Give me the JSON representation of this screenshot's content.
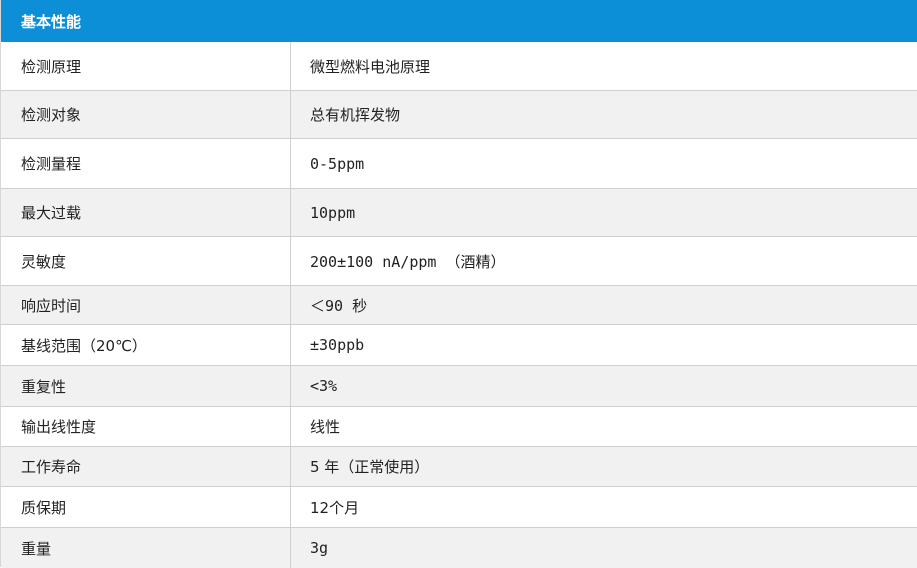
{
  "table": {
    "title": "基本性能",
    "rows": [
      {
        "label": "检测原理",
        "value": "微型燃料电池原理"
      },
      {
        "label": "检测对象",
        "value": "总有机挥发物"
      },
      {
        "label": "检测量程",
        "value": "0-5ppm"
      },
      {
        "label": "最大过载",
        "value": "10ppm"
      },
      {
        "label": "灵敏度",
        "value": "200±100 nA/ppm （酒精）"
      },
      {
        "label": "响应时间",
        "value": "＜90 秒"
      },
      {
        "label": "基线范围（20℃）",
        "value": "±30ppb"
      },
      {
        "label": "重复性",
        "value": "<3%"
      },
      {
        "label": "输出线性度",
        "value": "线性"
      },
      {
        "label": "工作寿命",
        "value": "5 年（正常使用）"
      },
      {
        "label": "质保期",
        "value": "12个月"
      },
      {
        "label": "重量",
        "value": "3g"
      }
    ]
  }
}
